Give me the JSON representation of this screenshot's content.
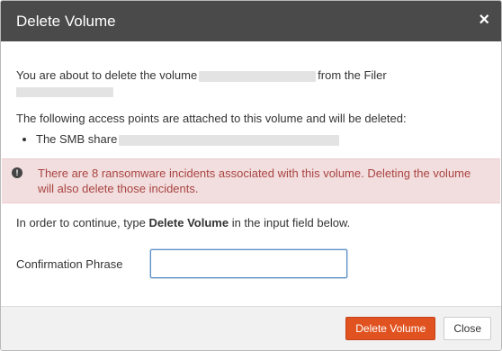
{
  "dialog": {
    "title": "Delete Volume",
    "close_label": "×"
  },
  "body": {
    "intro_prefix": "You are about to delete the volume",
    "intro_middle": "from the Filer",
    "access_points_text": "The following access points are attached to this volume and will be deleted:",
    "access_points": [
      {
        "label": "The SMB share"
      }
    ],
    "alert": {
      "icon": "!",
      "text": "There are 8 ransomware incidents associated with this volume. Deleting the volume will also delete those incidents."
    },
    "instruction_prefix": "In order to continue, type",
    "instruction_phrase": "Delete Volume",
    "instruction_suffix": "in the input field below."
  },
  "form": {
    "label": "Confirmation Phrase",
    "value": "",
    "placeholder": ""
  },
  "footer": {
    "delete_label": "Delete Volume",
    "close_label": "Close"
  },
  "colors": {
    "header_bg": "#4a4a4a",
    "alert_bg": "#f2dede",
    "alert_text": "#a94442",
    "primary_button": "#e0521f"
  },
  "icons": {
    "close": "close-icon",
    "alert": "exclamation-circle-icon",
    "bullet": "bullet-icon"
  }
}
